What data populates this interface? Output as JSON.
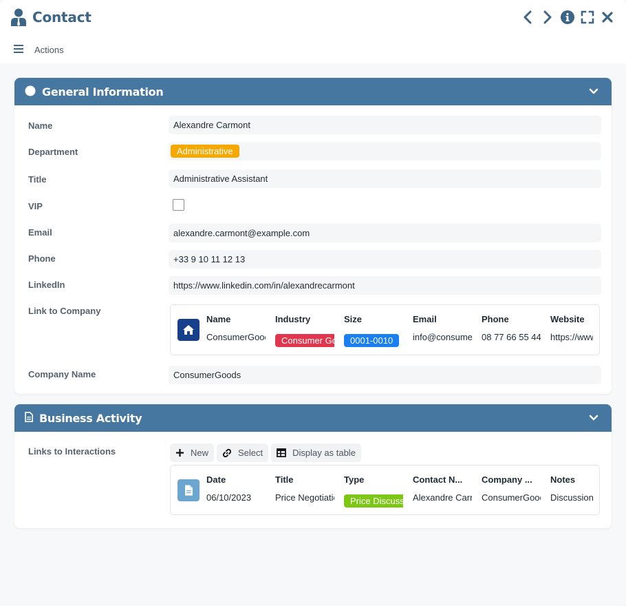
{
  "app": {
    "title": "Contact",
    "actions_label": "Actions"
  },
  "icons": {
    "title": "user-tie-icon",
    "prev": "chevron-left-icon",
    "next": "chevron-right-icon",
    "info": "info-circle-icon",
    "fullscreen": "expand-icon",
    "close": "close-icon",
    "menu": "hamburger-icon"
  },
  "general": {
    "title": "General Information",
    "fields": {
      "name": {
        "label": "Name",
        "value": "Alexandre Carmont"
      },
      "department": {
        "label": "Department",
        "value": "Administrative",
        "color": "#f5a800"
      },
      "title": {
        "label": "Title",
        "value": "Administrative Assistant"
      },
      "vip": {
        "label": "VIP",
        "checked": false
      },
      "email": {
        "label": "Email",
        "value": "alexandre.carmont@example.com"
      },
      "phone": {
        "label": "Phone",
        "value": "+33 9 10 11 12 13"
      },
      "linkedin": {
        "label": "LinkedIn",
        "value": "https://www.linkedin.com/in/alexandrecarmont"
      },
      "company_link": {
        "label": "Link to Company",
        "columns": [
          "Name",
          "Industry",
          "Size",
          "Email",
          "Phone",
          "Website"
        ],
        "row": {
          "name": "ConsumerGoods",
          "industry": "Consumer Goods",
          "industry_color": "#e0374f",
          "size": "0001-0010",
          "size_color": "#1a7ff0",
          "email": "info@consumergoods.com",
          "phone": "08 77 66 55 44",
          "website": "https://www.consumergoods.com"
        }
      },
      "company_name": {
        "label": "Company Name",
        "value": "ConsumerGoods"
      }
    }
  },
  "business": {
    "title": "Business Activity",
    "interactions": {
      "label": "Links to Interactions",
      "buttons": {
        "new": "New",
        "select": "Select",
        "table": "Display as table"
      },
      "columns": [
        "Date",
        "Title",
        "Type",
        "Contact N...",
        "Company ...",
        "Notes"
      ],
      "row": {
        "date": "06/10/2023",
        "title": "Price Negotiation",
        "type": "Price Discussion",
        "type_color": "#7cc614",
        "contact": "Alexandre Carmont",
        "company": "ConsumerGoods",
        "notes": "Discussion"
      }
    }
  },
  "colors": {
    "header": "#4577a0",
    "title_text": "#3d6585",
    "company_icon_bg": "#163f8c",
    "interaction_icon_bg": "#6aa6cf"
  }
}
